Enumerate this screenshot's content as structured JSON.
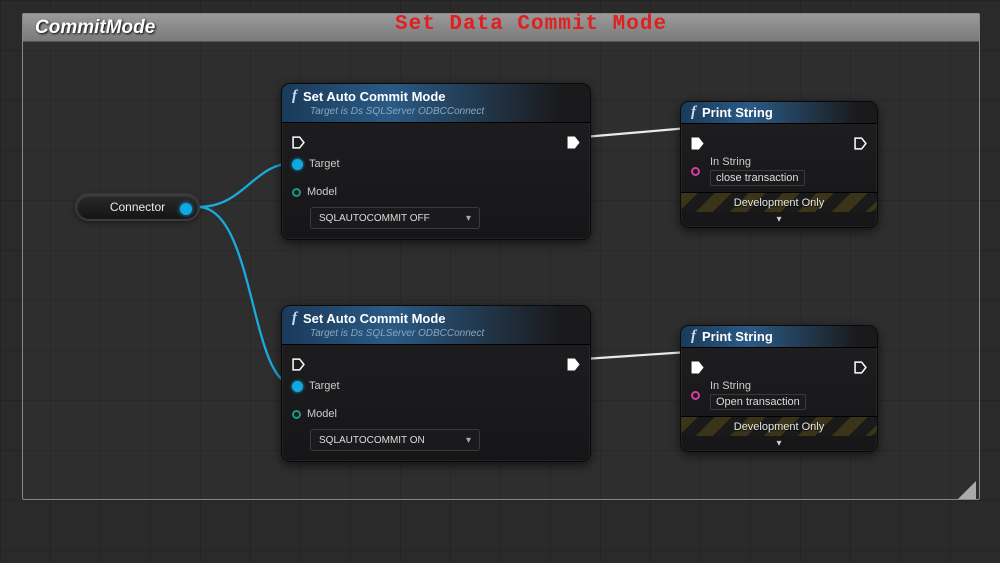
{
  "comment": {
    "title": "CommitMode"
  },
  "overlay_title": "Set Data Commit Mode",
  "connector": {
    "label": "Connector"
  },
  "nodes": {
    "setAuto1": {
      "title": "Set Auto Commit Mode",
      "subtitle": "Target is Ds SQLServer ODBCConnect",
      "target_label": "Target",
      "model_label": "Model",
      "model_value": "SQLAUTOCOMMIT OFF"
    },
    "setAuto2": {
      "title": "Set Auto Commit Mode",
      "subtitle": "Target is Ds SQLServer ODBCConnect",
      "target_label": "Target",
      "model_label": "Model",
      "model_value": "SQLAUTOCOMMIT ON"
    },
    "print1": {
      "title": "Print String",
      "in_string_label": "In String",
      "in_string_value": "close transaction",
      "dev_label": "Development Only"
    },
    "print2": {
      "title": "Print String",
      "in_string_label": "In String",
      "in_string_value": "Open transaction",
      "dev_label": "Development Only"
    }
  }
}
